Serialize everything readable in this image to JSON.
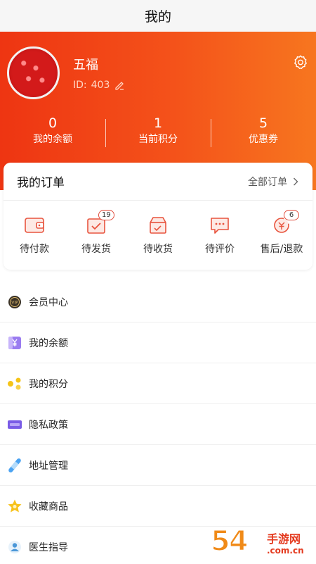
{
  "header": {
    "title": "我的"
  },
  "profile": {
    "name": "五福",
    "id_prefix": "ID:",
    "id_value": "403"
  },
  "stats": [
    {
      "value": "0",
      "label": "我的余额"
    },
    {
      "value": "1",
      "label": "当前积分"
    },
    {
      "value": "5",
      "label": "优惠券"
    }
  ],
  "orders": {
    "title": "我的订单",
    "all_label": "全部订单",
    "items": [
      {
        "label": "待付款",
        "icon": "wallet-icon",
        "badge": ""
      },
      {
        "label": "待发货",
        "icon": "box-check-icon",
        "badge": "19"
      },
      {
        "label": "待收货",
        "icon": "package-icon",
        "badge": ""
      },
      {
        "label": "待评价",
        "icon": "chat-bubble-icon",
        "badge": ""
      },
      {
        "label": "售后/退款",
        "icon": "refund-icon",
        "badge": "6"
      }
    ]
  },
  "menu": [
    {
      "label": "会员中心",
      "icon": "vip-badge-icon"
    },
    {
      "label": "我的余额",
      "icon": "yuan-card-icon"
    },
    {
      "label": "我的积分",
      "icon": "points-icon"
    },
    {
      "label": "隐私政策",
      "icon": "policy-icon"
    },
    {
      "label": "地址管理",
      "icon": "address-pin-icon"
    },
    {
      "label": "收藏商品",
      "icon": "star-icon"
    },
    {
      "label": "医生指导",
      "icon": "doctor-icon"
    }
  ],
  "watermark": {
    "big": "54",
    "cn": "手游网",
    "url": ".com.cn"
  },
  "colors": {
    "accent": "#f04a18",
    "accent_light": "#f7761f"
  }
}
